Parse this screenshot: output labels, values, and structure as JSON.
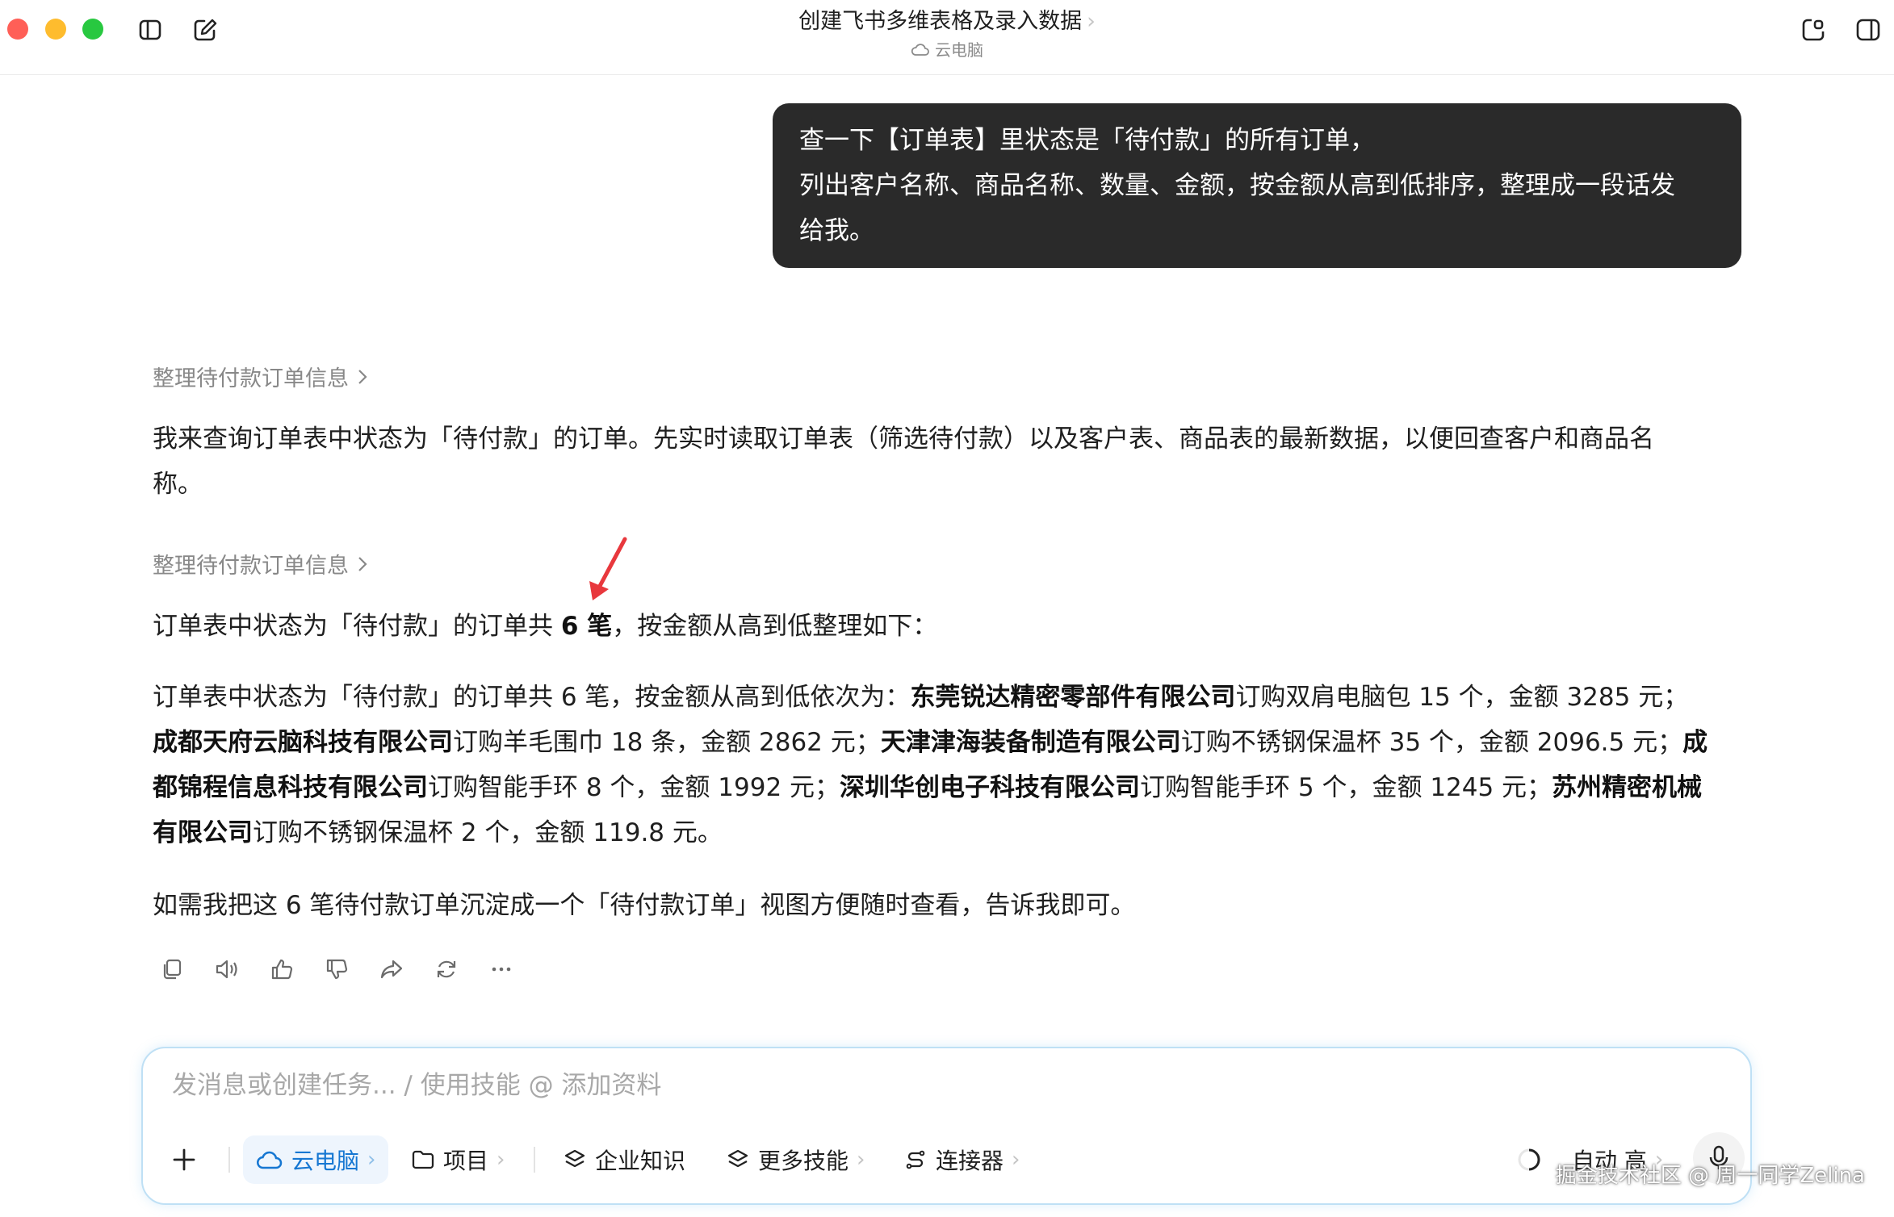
{
  "window": {
    "title": "创建飞书多维表格及录入数据",
    "title_chevron": "›",
    "subtitle": "云电脑"
  },
  "user_message": {
    "line1": "查一下【订单表】里状态是「待付款」的所有订单，",
    "line2": "列出客户名称、商品名称、数量、金额，按金额从高到低排序，整理成一段话发",
    "line3": "给我。"
  },
  "assistant": {
    "step1": "整理待付款订单信息",
    "intro_line1": "我来查询订单表中状态为「待付款」的订单。先实时读取订单表（筛选待付款）以及客户表、商品表的最新数据，以便回查客户和商品名",
    "intro_line2": "称。",
    "step2": "整理待付款订单信息",
    "summary_prefix": "订单表中状态为「待付款」的订单共 ",
    "summary_bold": "6 笔",
    "summary_suffix": "，按金额从高到低整理如下：",
    "detail": {
      "l1_text": "订单表中状态为「待付款」的订单共 6 笔，按金额从高到低依次为：",
      "l1_b1": "东莞锐达精密零部件有限公司",
      "l1_t2": "订购双肩电脑包 15 个，金额 3285 元；",
      "l2_b1": "成都天府云脑科技有限公司",
      "l2_t1": "订购羊毛围巾 18 条，金额 2862 元；",
      "l2_b2": "天津津海装备制造有限公司",
      "l2_t2": "订购不锈钢保温杯 35 个，金额 2096.5 元；",
      "l2_b3": "成",
      "l3_b1": "都锦程信息科技有限公司",
      "l3_t1": "订购智能手环 8 个，金额 1992 元；",
      "l3_b2": "深圳华创电子科技有限公司",
      "l3_t2": "订购智能手环 5 个，金额 1245 元；",
      "l3_b3": "苏州精密机械",
      "l4_b1": "有限公司",
      "l4_t1": "订购不锈钢保温杯 2 个，金额 119.8 元。"
    },
    "closing": "如需我把这 6 笔待付款订单沉淀成一个「待付款订单」视图方便随时查看，告诉我即可。"
  },
  "composer": {
    "placeholder": "发消息或创建任务... / 使用技能 @ 添加资料",
    "tools": {
      "cloud": "云电脑",
      "project": "项目",
      "knowledge": "企业知识",
      "skills": "更多技能",
      "connector": "连接器",
      "mode": "自动 高"
    }
  },
  "watermark": "掘金技术社区 @ 周一同学Zelina",
  "colors": {
    "bubble_bg": "#2a2a2a",
    "accent_blue": "#1677d2",
    "annotation_arrow": "#e8383d"
  }
}
